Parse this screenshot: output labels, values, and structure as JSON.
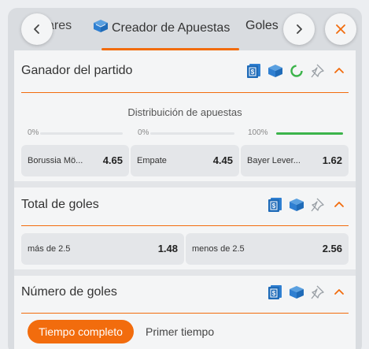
{
  "tabs": {
    "prev_partial": "ares",
    "active": "Creador de Apuestas",
    "next": "Goles"
  },
  "colors": {
    "accent": "#f26c0d",
    "progress": "#3cb44b",
    "icon_blue": "#2f7fd1"
  },
  "icons": {
    "nav_left": "chevron-left-icon",
    "nav_right": "chevron-right-icon",
    "close": "close-icon",
    "cash": "cash-icon",
    "builder": "cube-icon",
    "loading": "spinner-icon",
    "pin": "pin-icon",
    "collapse": "chevron-up-icon"
  },
  "markets": [
    {
      "title": "Ganador del partido",
      "distribution": {
        "title": "Distribuición de apuestas",
        "items": [
          {
            "label": "0%",
            "value": 0
          },
          {
            "label": "0%",
            "value": 0
          },
          {
            "label": "100%",
            "value": 1.0
          }
        ]
      },
      "odds": [
        {
          "label": "Borussia Mö...",
          "value": "4.65"
        },
        {
          "label": "Empate",
          "value": "4.45"
        },
        {
          "label": "Bayer Lever...",
          "value": "1.62"
        }
      ]
    },
    {
      "title": "Total de goles",
      "odds": [
        {
          "label": "más de 2.5",
          "value": "1.48"
        },
        {
          "label": "menos de 2.5",
          "value": "2.56"
        }
      ]
    },
    {
      "title": "Número de goles",
      "toggle": {
        "active": "Tiempo completo",
        "inactive": "Primer tiempo"
      }
    }
  ]
}
